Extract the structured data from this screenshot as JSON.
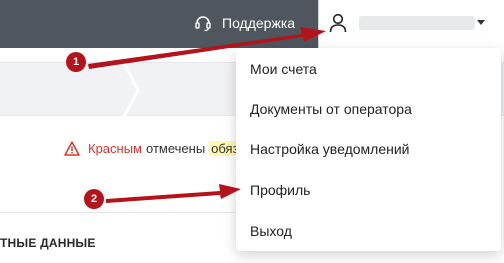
{
  "header": {
    "support_label": "Поддержка",
    "support_icon": "headset-icon",
    "user_icon": "user-icon"
  },
  "user_menu": {
    "items": [
      {
        "label": "Мои счета"
      },
      {
        "label": "Документы от оператора"
      },
      {
        "label": "Настройка уведомлений"
      },
      {
        "label": "Профиль"
      },
      {
        "label": "Выход"
      }
    ]
  },
  "notice": {
    "red_word": "Красным",
    "text": "отмечены",
    "highlighted": "обяз"
  },
  "section": {
    "title": "ТНЫЕ ДАННЫЕ"
  },
  "annotations": {
    "marker_1": "1",
    "marker_2": "2"
  },
  "colors": {
    "topbar": "#50565e",
    "accent_red": "#b3131a",
    "warning_red": "#d9322b",
    "highlight": "#fff7b0"
  }
}
